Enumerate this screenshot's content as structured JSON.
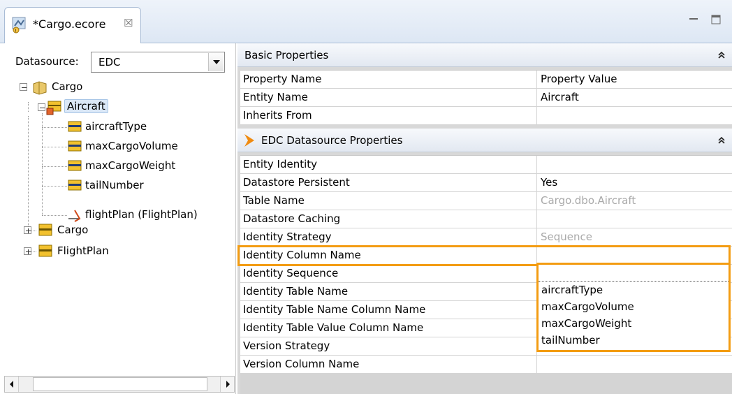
{
  "editor": {
    "tab_title": "*Cargo.ecore",
    "tab_icon": "ecore-model-icon",
    "close_glyph": "☒"
  },
  "datasource": {
    "label": "Datasource:",
    "value": "EDC"
  },
  "tree": {
    "root": "Cargo",
    "items": [
      {
        "label": "Aircraft",
        "selected": true
      },
      {
        "label": "aircraftType"
      },
      {
        "label": "maxCargoVolume"
      },
      {
        "label": "maxCargoWeight"
      },
      {
        "label": "tailNumber"
      },
      {
        "label": "flightPlan (FlightPlan)"
      },
      {
        "label": "Cargo"
      },
      {
        "label": "FlightPlan"
      }
    ]
  },
  "basic_properties": {
    "title": "Basic Properties",
    "header": {
      "name": "Property Name",
      "value": "Property Value"
    },
    "rows": [
      {
        "name": "Entity Name",
        "value": "Aircraft"
      },
      {
        "name": "Inherits From",
        "value": ""
      }
    ]
  },
  "edc_properties": {
    "title": "EDC Datasource Properties",
    "rows": [
      {
        "name": "Entity Identity",
        "value": ""
      },
      {
        "name": "Datastore Persistent",
        "value": "Yes"
      },
      {
        "name": "Table Name",
        "value": "Cargo.dbo.Aircraft"
      },
      {
        "name": "Datastore Caching",
        "value": ""
      },
      {
        "name": "Identity Strategy",
        "value": "Sequence"
      },
      {
        "name": "Identity Column Name",
        "value": ""
      },
      {
        "name": "Identity Sequence",
        "value": ""
      },
      {
        "name": "Identity Table Name",
        "value": ""
      },
      {
        "name": "Identity Table Name Column Name",
        "value": ""
      },
      {
        "name": "Identity Table Value Column Name",
        "value": ""
      },
      {
        "name": "Version Strategy",
        "value": ""
      },
      {
        "name": "Version Column Name",
        "value": ""
      }
    ]
  },
  "dropdown": {
    "options": [
      "aircraftType",
      "maxCargoVolume",
      "maxCargoWeight",
      "tailNumber"
    ]
  },
  "colors": {
    "highlight": "#f39c12",
    "dim_text": "#a9a9a9",
    "entity_icon": "#f2c12e"
  }
}
